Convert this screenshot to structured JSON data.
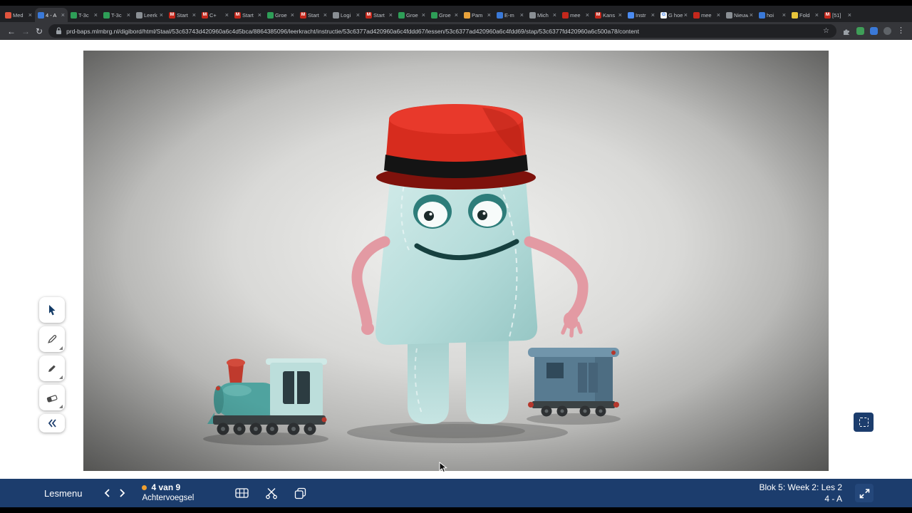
{
  "browser": {
    "url": "prd-baps.mlmbrg.nl/digibord/html/Staal/53c63743d420960a6c4d5bca/8864385096/leerkracht/instructie/53c6377ad420960a6c4fddd67/lessen/53c6377ad420960a6c4fdd69/stap/53c6377fd420960a6c500a78/content",
    "tab_close_glyph": "×",
    "new_tab_glyph": "+",
    "back_glyph": "←",
    "forward_glyph": "→",
    "reload_glyph": "↻",
    "bookmark_glyph": "☆",
    "menu_glyph": "⋮",
    "tabs": [
      {
        "t": "Med",
        "c": "#e1543e"
      },
      {
        "t": "4 - A",
        "c": "#3a79d8",
        "cls": "active"
      },
      {
        "t": "T-3c",
        "c": "#2e9e57"
      },
      {
        "t": "T-3c",
        "c": "#2e9e57"
      },
      {
        "t": "Leerk",
        "c": "#8a8f94"
      },
      {
        "t": "Start",
        "c": "#c4281c",
        "l": "M"
      },
      {
        "t": "C+",
        "c": "#c4281c",
        "l": "M"
      },
      {
        "t": "Start",
        "c": "#c4281c",
        "l": "M"
      },
      {
        "t": "Groe",
        "c": "#2e9e57"
      },
      {
        "t": "Start",
        "c": "#c4281c",
        "l": "M"
      },
      {
        "t": "Logi",
        "c": "#8a8f94"
      },
      {
        "t": "Start",
        "c": "#c4281c",
        "l": "M"
      },
      {
        "t": "Groe",
        "c": "#2e9e57"
      },
      {
        "t": "Groe",
        "c": "#2e9e57"
      },
      {
        "t": "Pam",
        "c": "#e8a23b"
      },
      {
        "t": "E-m",
        "c": "#3a79d8"
      },
      {
        "t": "Mich",
        "c": "#8a8f94"
      },
      {
        "t": "mee",
        "c": "#c4281c"
      },
      {
        "t": "Kans",
        "c": "#c4281c",
        "l": "M"
      },
      {
        "t": "Instr",
        "c": "#4b8bf0"
      },
      {
        "t": "G hoe",
        "c": "#f1f3f4",
        "l": "G",
        "lc": "#4285f4"
      },
      {
        "t": "mee",
        "c": "#c4281c"
      },
      {
        "t": "Nieuw",
        "c": "#8a8f94"
      },
      {
        "t": "hoi",
        "c": "#3a79d8"
      },
      {
        "t": "Fold",
        "c": "#e8c53b"
      },
      {
        "t": "[51]",
        "c": "#c4281c",
        "l": "M"
      }
    ]
  },
  "side_toolbar": {
    "tools": [
      "cursor",
      "pencil",
      "marker",
      "eraser",
      "collapse"
    ]
  },
  "bottom_bar": {
    "menu_label": "Lesmenu",
    "progress_label": "4 van 9",
    "step_title": "Achtervoegsel",
    "lesson_label": "Blok 5: Week 2: Les 2",
    "lesson_code": "4 - A"
  },
  "colors": {
    "bottom_bar_bg": "#1c3d6d",
    "progress_dot": "#f0a030",
    "browser_tabstrip": "#202124",
    "browser_toolbar": "#35363a",
    "character_body": "#b7dedc",
    "character_hat_red": "#d72c1e",
    "character_arms_pink": "#e39aa3",
    "train_teal": "#4fa39f",
    "wagon_blue": "#587b91",
    "stage_bg_center": "#f2f2f0",
    "stage_bg_edge": "#757573"
  }
}
